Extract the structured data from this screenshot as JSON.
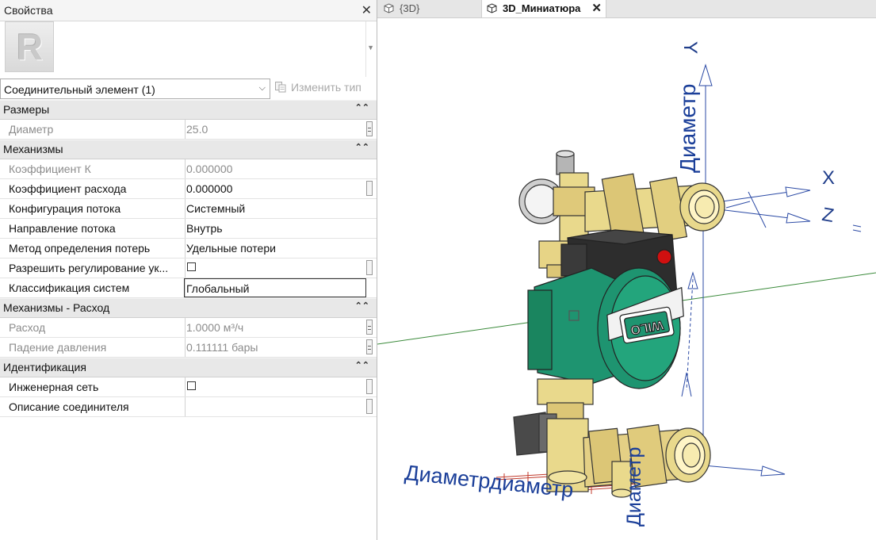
{
  "properties": {
    "title": "Свойства",
    "type_selector": "Соединительный элемент (1)",
    "edit_type_label": "Изменить тип",
    "groups": [
      {
        "title": "Размеры",
        "rows": [
          {
            "name": "Диаметр",
            "value": "25.0"
          }
        ]
      },
      {
        "title": "Механизмы",
        "rows": [
          {
            "name": "Коэффициент К",
            "value": "0.000000"
          },
          {
            "name": "Коэффициент расхода",
            "value": "0.000000"
          },
          {
            "name": "Конфигурация потока",
            "value": "Системный"
          },
          {
            "name": "Направление потока",
            "value": "Внутрь"
          },
          {
            "name": "Метод определения потерь",
            "value": "Удельные потери"
          },
          {
            "name": "Разрешить регулирование ук...",
            "value": ""
          },
          {
            "name": "Классификация систем",
            "value": "Глобальный"
          }
        ]
      },
      {
        "title": "Механизмы - Расход",
        "rows": [
          {
            "name": "Расход",
            "value": "1.0000 м³/ч"
          },
          {
            "name": "Падение давления",
            "value": "0.111111 бары"
          }
        ]
      },
      {
        "title": "Идентификация",
        "rows": [
          {
            "name": "Инженерная сеть",
            "value": ""
          },
          {
            "name": "Описание соединителя",
            "value": ""
          }
        ]
      }
    ]
  },
  "view": {
    "tabs": [
      {
        "label": "{3D}"
      },
      {
        "label": "3D_Миниатюра"
      }
    ],
    "axes": {
      "y": "Y",
      "x": "X",
      "z": "Z"
    },
    "dimension_label": "Диаметр",
    "dimension_label_overlap": "Диаметрдиаметр",
    "brand": "WILO"
  },
  "colors": {
    "pump_green": "#1e9470",
    "brass": "#e9d98c",
    "axis_blue": "#2b4aa5",
    "axis_green": "#3a8a3a",
    "dim_red": "#c0392b"
  }
}
